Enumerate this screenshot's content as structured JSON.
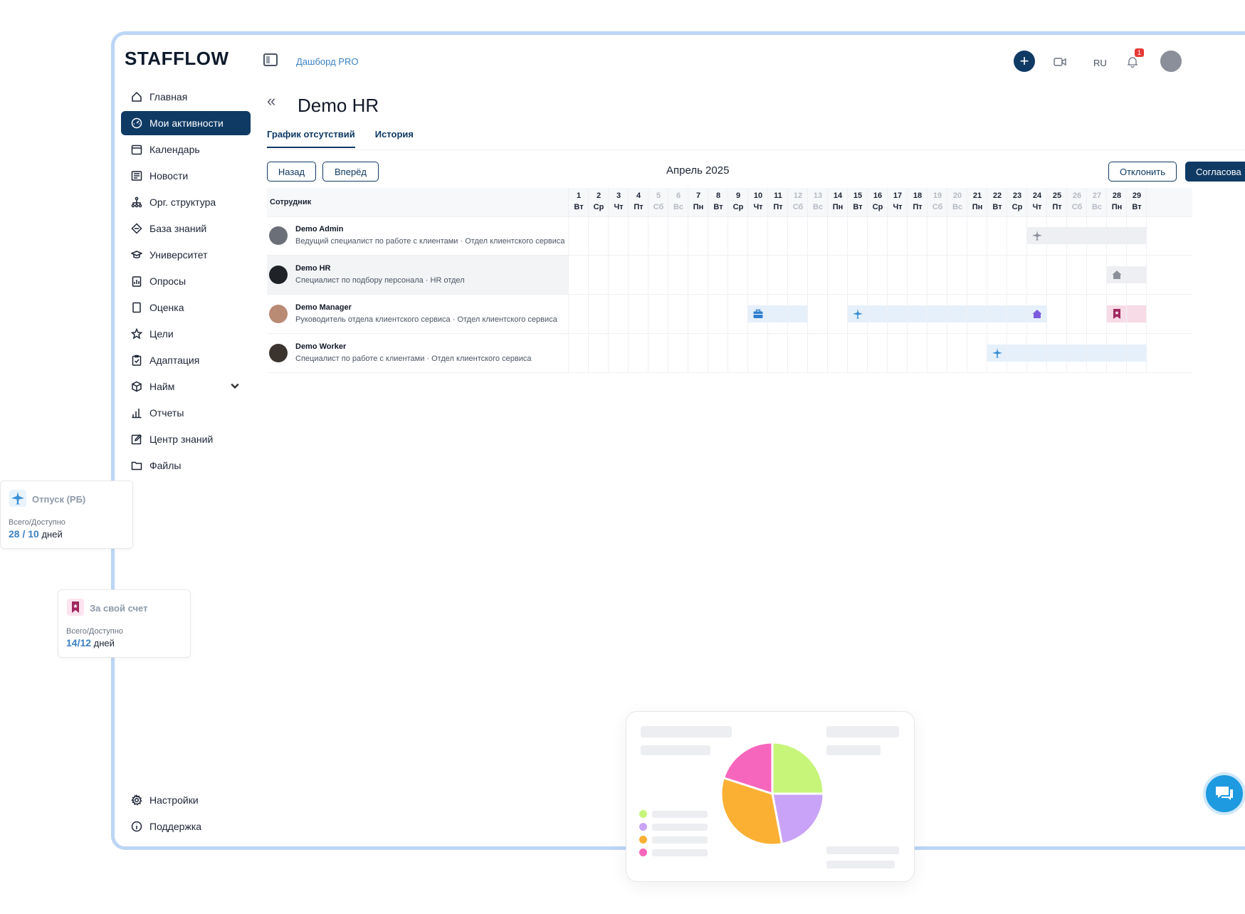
{
  "app": {
    "logo": "STAFFLOW",
    "breadcrumb": "Дашборд PRO",
    "lang": "RU",
    "notif_count": "1"
  },
  "sidebar": {
    "items": [
      {
        "label": "Главная",
        "icon": "home-icon"
      },
      {
        "label": "Мои активности",
        "icon": "gauge-icon",
        "active": true
      },
      {
        "label": "Календарь",
        "icon": "calendar-icon"
      },
      {
        "label": "Новости",
        "icon": "news-icon"
      },
      {
        "label": "Орг. структура",
        "icon": "org-structure-icon"
      },
      {
        "label": "База знаний",
        "icon": "knowledge-base-icon"
      },
      {
        "label": "Университет",
        "icon": "graduation-cap-icon"
      },
      {
        "label": "Опросы",
        "icon": "survey-icon"
      },
      {
        "label": "Оценка",
        "icon": "assessment-icon"
      },
      {
        "label": "Цели",
        "icon": "star-icon"
      },
      {
        "label": "Адаптация",
        "icon": "clipboard-check-icon"
      },
      {
        "label": "Найм",
        "icon": "cube-icon",
        "has_children": true
      },
      {
        "label": "Отчеты",
        "icon": "bar-chart-icon"
      },
      {
        "label": "Центр знаний",
        "icon": "edit-icon"
      },
      {
        "label": "Файлы",
        "icon": "folder-icon"
      }
    ],
    "bottom": [
      {
        "label": "Настройки",
        "icon": "gear-icon"
      },
      {
        "label": "Поддержка",
        "icon": "info-icon"
      }
    ]
  },
  "page": {
    "title": "Demo HR",
    "tabs": [
      "График отсутствий",
      "История"
    ],
    "prev_label": "Назад",
    "next_label": "Вперёд",
    "month": "Апрель 2025",
    "reject_label": "Отклонить",
    "approve_label": "Согласова"
  },
  "grid": {
    "employee_header": "Сотрудник",
    "days": [
      {
        "n": "1",
        "d": "Вт"
      },
      {
        "n": "2",
        "d": "Ср"
      },
      {
        "n": "3",
        "d": "Чт"
      },
      {
        "n": "4",
        "d": "Пт"
      },
      {
        "n": "5",
        "d": "Сб",
        "we": true
      },
      {
        "n": "6",
        "d": "Вс",
        "we": true
      },
      {
        "n": "7",
        "d": "Пн"
      },
      {
        "n": "8",
        "d": "Вт"
      },
      {
        "n": "9",
        "d": "Ср"
      },
      {
        "n": "10",
        "d": "Чт"
      },
      {
        "n": "11",
        "d": "Пт"
      },
      {
        "n": "12",
        "d": "Сб",
        "we": true
      },
      {
        "n": "13",
        "d": "Вс",
        "we": true
      },
      {
        "n": "14",
        "d": "Пн"
      },
      {
        "n": "15",
        "d": "Вт"
      },
      {
        "n": "16",
        "d": "Ср"
      },
      {
        "n": "17",
        "d": "Чт"
      },
      {
        "n": "18",
        "d": "Пт"
      },
      {
        "n": "19",
        "d": "Сб",
        "we": true
      },
      {
        "n": "20",
        "d": "Вс",
        "we": true
      },
      {
        "n": "21",
        "d": "Пн"
      },
      {
        "n": "22",
        "d": "Вт"
      },
      {
        "n": "23",
        "d": "Ср"
      },
      {
        "n": "24",
        "d": "Чт"
      },
      {
        "n": "25",
        "d": "Пт"
      },
      {
        "n": "26",
        "d": "Сб",
        "we": true
      },
      {
        "n": "27",
        "d": "Вс",
        "we": true
      },
      {
        "n": "28",
        "d": "Пн"
      },
      {
        "n": "29",
        "d": "Вт"
      }
    ],
    "employees": [
      {
        "name": "Demo Admin",
        "sub": "Ведущий специалист по работе с клиентами  ·  Отдел клиентского сервиса",
        "avatar_color": "#6b6f78",
        "bars": [
          {
            "from": 24,
            "to": 29,
            "color": "grey"
          }
        ],
        "events": [
          {
            "day": 24,
            "icon": "airplane-icon",
            "color": "#8a8f99"
          }
        ]
      },
      {
        "name": "Demo HR",
        "sub": "Специалист по подбору персонала  ·  HR отдел",
        "avatar_color": "#1f2328",
        "highlight": true,
        "bars": [
          {
            "from": 28,
            "to": 29,
            "color": "grey"
          }
        ],
        "events": [
          {
            "day": 28,
            "icon": "home-icon",
            "color": "#8a8f99"
          }
        ]
      },
      {
        "name": "Demo Manager",
        "sub": "Руководитель отдела клиентского сервиса  ·  Отдел клиентского сервиса",
        "avatar_color": "#b98a74",
        "bars": [
          {
            "from": 10,
            "to": 12,
            "color": "blue"
          },
          {
            "from": 15,
            "to": 24,
            "color": "blue"
          },
          {
            "from": 28,
            "to": 29,
            "color": "pink"
          }
        ],
        "events": [
          {
            "day": 10,
            "icon": "briefcase-icon",
            "color": "#2f7fd1"
          },
          {
            "day": 15,
            "icon": "airplane-icon",
            "color": "#3b8fd6"
          },
          {
            "day": 24,
            "icon": "home-icon",
            "color": "#7c5ce0"
          },
          {
            "day": 28,
            "icon": "bookmark-icon",
            "color": "#a0265e"
          }
        ]
      },
      {
        "name": "Demo Worker",
        "sub": "Специалист по работе с клиентами  ·  Отдел клиентского сервиса",
        "avatar_color": "#3a332e",
        "bars": [
          {
            "from": 22,
            "to": 29,
            "color": "blue"
          }
        ],
        "events": [
          {
            "day": 22,
            "icon": "airplane-icon",
            "color": "#3b8fd6"
          }
        ]
      }
    ]
  },
  "cards": {
    "vacation": {
      "title": "Отпуск (РБ)",
      "label": "Всего/Доступно",
      "value": "28 / 10",
      "unit": "дней",
      "icon": "airplane-icon"
    },
    "own_expense": {
      "title": "За свой счет",
      "label": "Всего/Доступно",
      "value": "14/12",
      "unit": "дней",
      "icon": "bookmark-icon"
    }
  },
  "chart_data": {
    "type": "pie",
    "values": [
      25,
      22,
      33,
      20
    ],
    "colors": [
      "#c6f57a",
      "#c9a3f7",
      "#fbb034",
      "#f766bd"
    ]
  }
}
